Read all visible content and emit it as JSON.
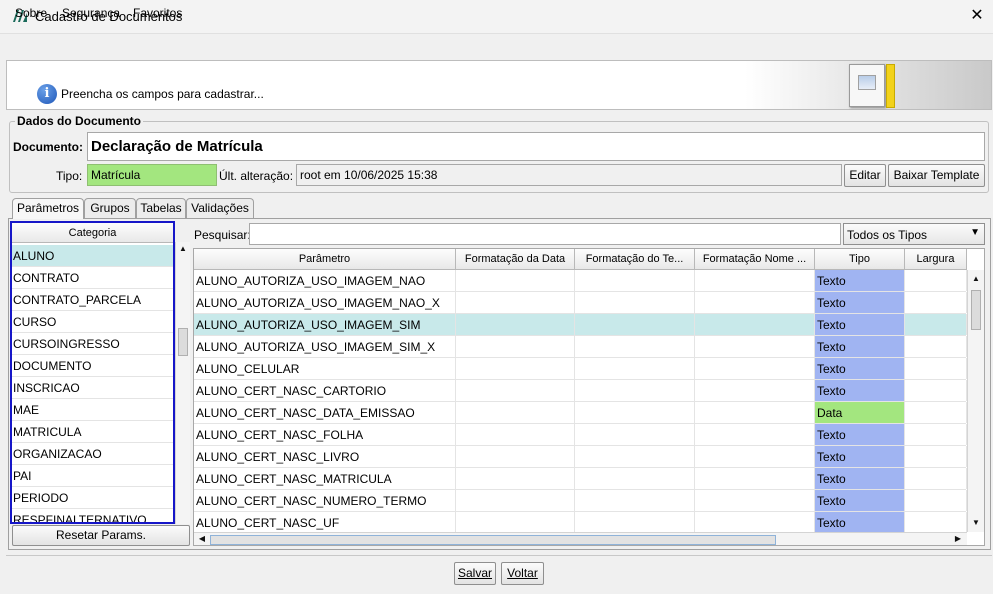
{
  "window": {
    "title": "Cadastro de Documentos",
    "close_symbol": "✕"
  },
  "menu": [
    "Sobre",
    "Segurança",
    "Favoritos"
  ],
  "info": {
    "message": "Preencha os campos para cadastrar..."
  },
  "dados": {
    "group_title": "Dados do Documento",
    "documento_label": "Documento:",
    "documento_value": "Declaração de Matrícula",
    "tipo_label": "Tipo:",
    "tipo_value": "Matrícula",
    "ult_label": "Últ. alteração:",
    "ult_value": "root em 10/06/2025 15:38",
    "editar_label": "Editar",
    "baixar_label": "Baixar Template"
  },
  "tabs": [
    "Parâmetros",
    "Grupos",
    "Tabelas",
    "Validações"
  ],
  "categoria": {
    "header": "Categoria",
    "items": [
      "ALUNO",
      "CONTRATO",
      "CONTRATO_PARCELA",
      "CURSO",
      "CURSOINGRESSO",
      "DOCUMENTO",
      "INSCRICAO",
      "MAE",
      "MATRICULA",
      "ORGANIZACAO",
      "PAI",
      "PERIODO",
      "RESPFINALTERNATIVO"
    ],
    "selected": "ALUNO",
    "reset_label": "Resetar Params."
  },
  "search": {
    "label": "Pesquisar:",
    "value": "",
    "filter_value": "Todos os Tipos"
  },
  "table": {
    "columns": [
      "Parâmetro",
      "Formatação da Data",
      "Formatação do Te...",
      "Formatação Nome ...",
      "Tipo",
      "Largura"
    ],
    "rows": [
      {
        "parametro": "ALUNO_AUTORIZA_USO_IMAGEM_NAO",
        "tipo": "Texto"
      },
      {
        "parametro": "ALUNO_AUTORIZA_USO_IMAGEM_NAO_X",
        "tipo": "Texto"
      },
      {
        "parametro": "ALUNO_AUTORIZA_USO_IMAGEM_SIM",
        "tipo": "Texto"
      },
      {
        "parametro": "ALUNO_AUTORIZA_USO_IMAGEM_SIM_X",
        "tipo": "Texto"
      },
      {
        "parametro": "ALUNO_CELULAR",
        "tipo": "Texto"
      },
      {
        "parametro": "ALUNO_CERT_NASC_CARTORIO",
        "tipo": "Texto"
      },
      {
        "parametro": "ALUNO_CERT_NASC_DATA_EMISSAO",
        "tipo": "Data"
      },
      {
        "parametro": "ALUNO_CERT_NASC_FOLHA",
        "tipo": "Texto"
      },
      {
        "parametro": "ALUNO_CERT_NASC_LIVRO",
        "tipo": "Texto"
      },
      {
        "parametro": "ALUNO_CERT_NASC_MATRICULA",
        "tipo": "Texto"
      },
      {
        "parametro": "ALUNO_CERT_NASC_NUMERO_TERMO",
        "tipo": "Texto"
      },
      {
        "parametro": "ALUNO_CERT_NASC_UF",
        "tipo": "Texto"
      }
    ],
    "selected_row": "ALUNO_AUTORIZA_USO_IMAGEM_SIM"
  },
  "type_colors": {
    "Texto": "#a0b4f2",
    "Data": "#a3e67f"
  },
  "footer": {
    "salvar_label": "Salvar",
    "voltar_label": "Voltar"
  }
}
